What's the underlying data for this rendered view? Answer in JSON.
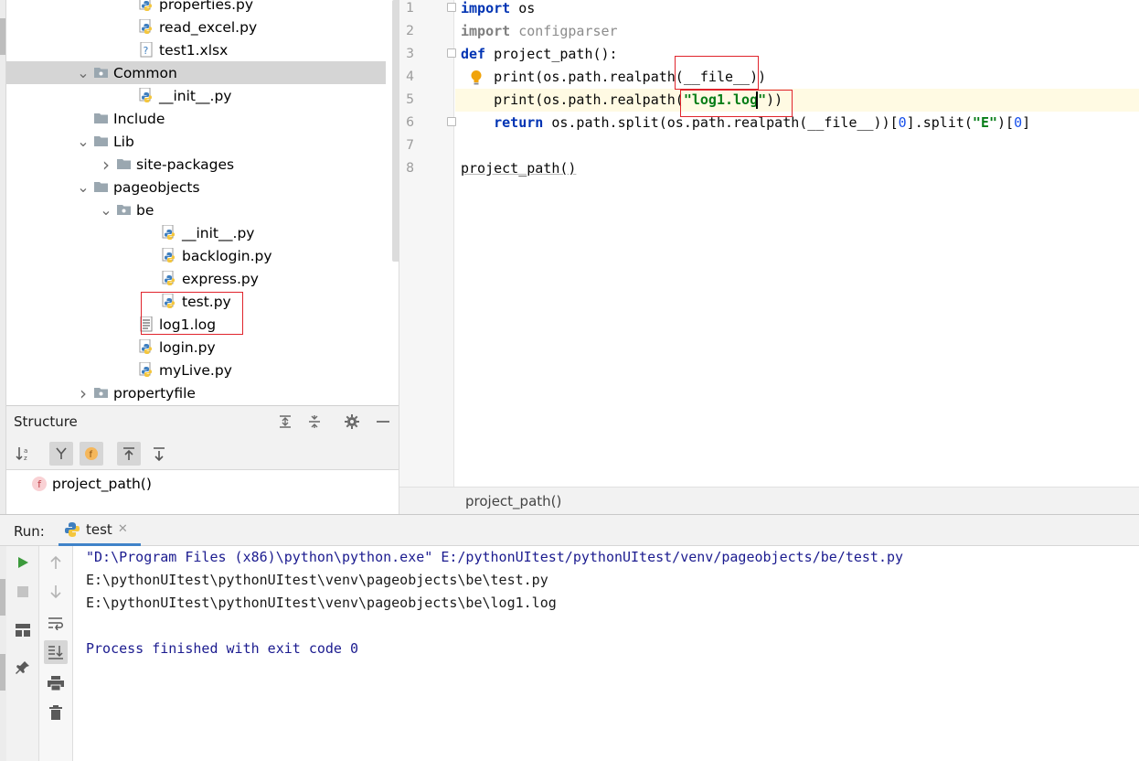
{
  "project_tree": {
    "items": [
      {
        "label": "properties.py",
        "type": "python"
      },
      {
        "label": "read_excel.py",
        "type": "python"
      },
      {
        "label": "test1.xlsx",
        "type": "unknown"
      },
      {
        "label": "Common",
        "type": "package",
        "expanded": true,
        "selected": true
      },
      {
        "label": "__init__.py",
        "type": "python"
      },
      {
        "label": "Include",
        "type": "folder"
      },
      {
        "label": "Lib",
        "type": "folder",
        "expanded": true
      },
      {
        "label": "site-packages",
        "type": "folder",
        "expanded": false
      },
      {
        "label": "pageobjects",
        "type": "folder",
        "expanded": true
      },
      {
        "label": "be",
        "type": "package",
        "expanded": true
      },
      {
        "label": "__init__.py",
        "type": "python"
      },
      {
        "label": "backlogin.py",
        "type": "python"
      },
      {
        "label": "express.py",
        "type": "python"
      },
      {
        "label": "test.py",
        "type": "python"
      },
      {
        "label": "log1.log",
        "type": "text"
      },
      {
        "label": "login.py",
        "type": "python"
      },
      {
        "label": "myLive.py",
        "type": "python"
      },
      {
        "label": "propertyfile",
        "type": "package",
        "expanded": false
      }
    ]
  },
  "structure": {
    "title": "Structure",
    "items": [
      {
        "label": "project_path()",
        "badge": "f"
      }
    ]
  },
  "editor": {
    "line_numbers": [
      "1",
      "2",
      "3",
      "4",
      "5",
      "6",
      "7",
      "8"
    ],
    "lines": {
      "l1_kw": "import",
      "l1_rest": " os",
      "l2_kw": "import",
      "l2_rest": " configparser",
      "l3_kw": "def",
      "l3_rest": " project_path():",
      "l4_a": "    print(os.path.realpath(",
      "l4_b": "__file__",
      "l4_c": "))",
      "l5_a": "    print(os.path.realpath(",
      "l5_str": "\"log1.log\"",
      "l5_c": "))",
      "l6_kw": "    return",
      "l6_a": " os.path.split(os.path.realpath(__file__))[",
      "l6_n1": "0",
      "l6_b": "].split(",
      "l6_str": "\"E\"",
      "l6_c": ")[",
      "l6_n2": "0",
      "l6_d": "]",
      "l8": "project_path()"
    },
    "breadcrumb": "project_path()"
  },
  "run": {
    "label": "Run:",
    "tab": "test",
    "console": [
      {
        "text": "\"D:\\Program Files (x86)\\python\\python.exe\" E:/pythonUItest/pythonUItest/venv/pageobjects/be/test.py",
        "color": "#1b1b8f"
      },
      {
        "text": "E:\\pythonUItest\\pythonUItest\\venv\\pageobjects\\be\\test.py",
        "color": "#1a1a1a"
      },
      {
        "text": "E:\\pythonUItest\\pythonUItest\\venv\\pageobjects\\be\\log1.log",
        "color": "#1a1a1a"
      },
      {
        "text": "",
        "color": "#1a1a1a"
      },
      {
        "text": "Process finished with exit code 0",
        "color": "#1b1b8f"
      }
    ]
  },
  "colors": {
    "highlight_box": "#e0242c",
    "folder": "#9aa7b0",
    "python_blue": "#3f7fbf",
    "python_yellow": "#f4c63d",
    "run_green": "#3c9a3c"
  }
}
